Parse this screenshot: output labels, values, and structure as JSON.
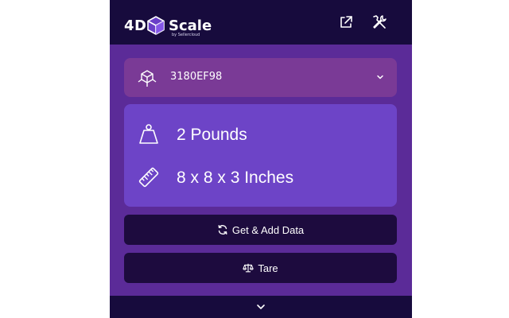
{
  "colors": {
    "header_bg": "#170b3d",
    "panel_bg": "#5b2b98",
    "device_select_bg": "#7a3a96",
    "readings_bg": "#6d44c7",
    "button_bg": "#1d0b3e",
    "text": "#ffffff"
  },
  "header": {
    "logo_4d": "4D",
    "logo_scale": "Scale",
    "logo_by": "by Sellercloud",
    "icons": [
      "external-link-icon",
      "tools-icon"
    ]
  },
  "device": {
    "selected": "3180EF98",
    "icon": "cube-icon"
  },
  "readings": {
    "weight": "2 Pounds",
    "weight_icon": "weight-icon",
    "dimensions": "8 x 8 x 3 Inches",
    "dimensions_icon": "ruler-icon"
  },
  "actions": {
    "get_add_label": "Get & Add Data",
    "get_add_icon": "refresh-icon",
    "tare_label": "Tare",
    "tare_icon": "balance-scale-icon"
  },
  "footer": {
    "icon": "chevron-down-icon"
  }
}
